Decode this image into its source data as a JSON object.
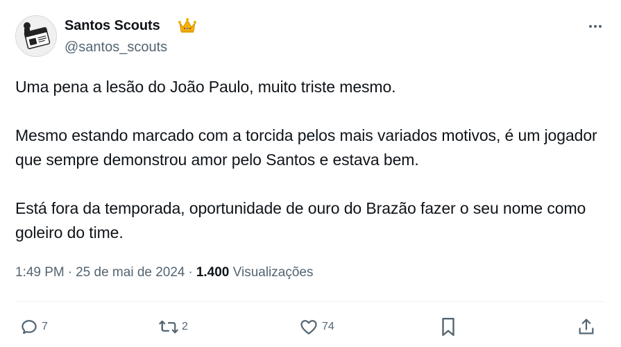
{
  "author": {
    "display_name": "Santos Scouts",
    "handle": "@santos_scouts",
    "badge_icon": "crown-icon",
    "avatar_icon": "santos-scouts-logo-icon"
  },
  "tweet": {
    "paragraphs": [
      "Uma pena a lesão do João Paulo, muito triste mesmo.",
      "Mesmo estando marcado com a torcida pelos mais variados motivos, é um jogador que sempre demonstrou amor pelo Santos e estava bem.",
      "Está fora da temporada, oportunidade de ouro do Brazão fazer o seu nome como goleiro do time."
    ],
    "time": "1:49 PM",
    "separator": "·",
    "date": "25 de mai de 2024",
    "views_count": "1.400",
    "views_label": "Visualizações"
  },
  "actions": {
    "reply_count": "7",
    "retweet_count": "2",
    "like_count": "74"
  },
  "colors": {
    "text": "#0f1419",
    "secondary": "#536471",
    "divider": "#eff3f4",
    "crown": "#f4b400"
  }
}
